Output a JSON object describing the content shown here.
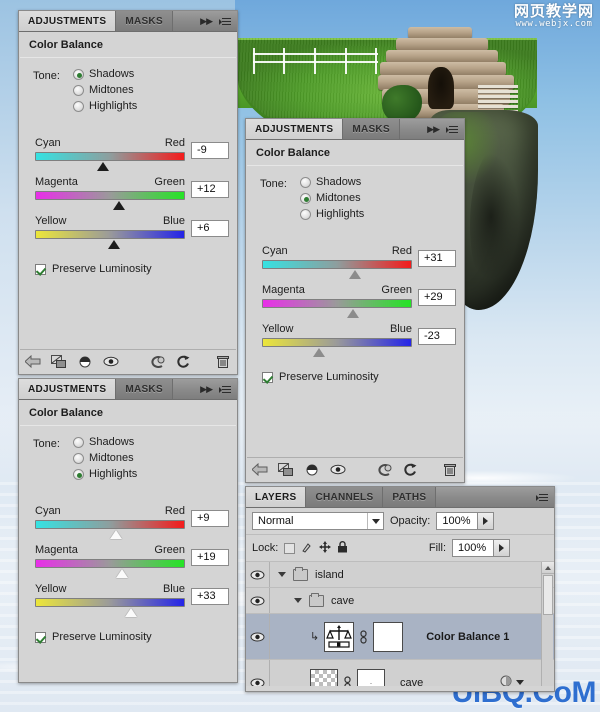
{
  "watermarks": {
    "top_cn": "网页教学网",
    "top_url": "www.webjx.com",
    "bottom": "UiBQ.CoM"
  },
  "panel_shadows": {
    "tabs": [
      {
        "label": "ADJUSTMENTS",
        "active": true
      },
      {
        "label": "MASKS",
        "active": false
      }
    ],
    "title": "Color Balance",
    "tone_label": "Tone:",
    "tone_options": [
      {
        "label": "Shadows",
        "selected": true
      },
      {
        "label": "Midtones",
        "selected": false
      },
      {
        "label": "Highlights",
        "selected": false
      }
    ],
    "sliders": [
      {
        "left_label": "Cyan",
        "right_label": "Red",
        "value": "-9",
        "position_pct": 45
      },
      {
        "left_label": "Magenta",
        "right_label": "Green",
        "value": "+12",
        "position_pct": 56
      },
      {
        "left_label": "Yellow",
        "right_label": "Blue",
        "value": "+6",
        "position_pct": 53
      }
    ],
    "preserve_label": "Preserve Luminosity",
    "preserve_checked": true,
    "toolbar_icons": [
      "back-arrow-icon",
      "clip-to-layer-icon",
      "contrast-toggle-icon",
      "eye-preview-icon",
      "previous-state-icon",
      "reset-icon",
      "delete-icon"
    ]
  },
  "panel_midtones": {
    "tabs": [
      {
        "label": "ADJUSTMENTS",
        "active": true
      },
      {
        "label": "MASKS",
        "active": false
      }
    ],
    "title": "Color Balance",
    "tone_label": "Tone:",
    "tone_options": [
      {
        "label": "Shadows",
        "selected": false
      },
      {
        "label": "Midtones",
        "selected": true
      },
      {
        "label": "Highlights",
        "selected": false
      }
    ],
    "sliders": [
      {
        "left_label": "Cyan",
        "right_label": "Red",
        "value": "+31",
        "position_pct": 62
      },
      {
        "left_label": "Magenta",
        "right_label": "Green",
        "value": "+29",
        "position_pct": 61
      },
      {
        "left_label": "Yellow",
        "right_label": "Blue",
        "value": "-23",
        "position_pct": 38
      }
    ],
    "preserve_label": "Preserve Luminosity",
    "preserve_checked": true,
    "toolbar_icons": [
      "back-arrow-icon",
      "clip-to-layer-icon",
      "contrast-toggle-icon",
      "eye-preview-icon",
      "previous-state-icon",
      "reset-icon",
      "delete-icon"
    ]
  },
  "panel_highlights": {
    "tabs": [
      {
        "label": "ADJUSTMENTS",
        "active": true
      },
      {
        "label": "MASKS",
        "active": false
      }
    ],
    "title": "Color Balance",
    "tone_label": "Tone:",
    "tone_options": [
      {
        "label": "Shadows",
        "selected": false
      },
      {
        "label": "Midtones",
        "selected": false
      },
      {
        "label": "Highlights",
        "selected": true
      }
    ],
    "sliders": [
      {
        "left_label": "Cyan",
        "right_label": "Red",
        "value": "+9",
        "position_pct": 54
      },
      {
        "left_label": "Magenta",
        "right_label": "Green",
        "value": "+19",
        "position_pct": 58
      },
      {
        "left_label": "Yellow",
        "right_label": "Blue",
        "value": "+33",
        "position_pct": 64
      }
    ],
    "preserve_label": "Preserve Luminosity",
    "preserve_checked": true
  },
  "layers_panel": {
    "tabs": [
      {
        "label": "LAYERS",
        "active": true
      },
      {
        "label": "CHANNELS",
        "active": false
      },
      {
        "label": "PATHS",
        "active": false
      }
    ],
    "blend_mode": "Normal",
    "opacity_label": "Opacity:",
    "opacity_value": "100%",
    "lock_label": "Lock:",
    "fill_label": "Fill:",
    "fill_value": "100%",
    "lock_icons": [
      "lock-transparency-icon",
      "lock-image-icon",
      "lock-position-icon",
      "lock-all-icon"
    ],
    "rows": [
      {
        "name": "island",
        "kind": "group",
        "indent": 0,
        "visible": true,
        "selected": false
      },
      {
        "name": "cave",
        "kind": "group",
        "indent": 1,
        "visible": true,
        "selected": false
      },
      {
        "name": "Color Balance 1",
        "kind": "adjustment",
        "indent": 2,
        "visible": true,
        "selected": true,
        "clipped": true
      },
      {
        "name": "cave",
        "kind": "pixel",
        "indent": 2,
        "visible": true,
        "selected": false
      }
    ]
  }
}
